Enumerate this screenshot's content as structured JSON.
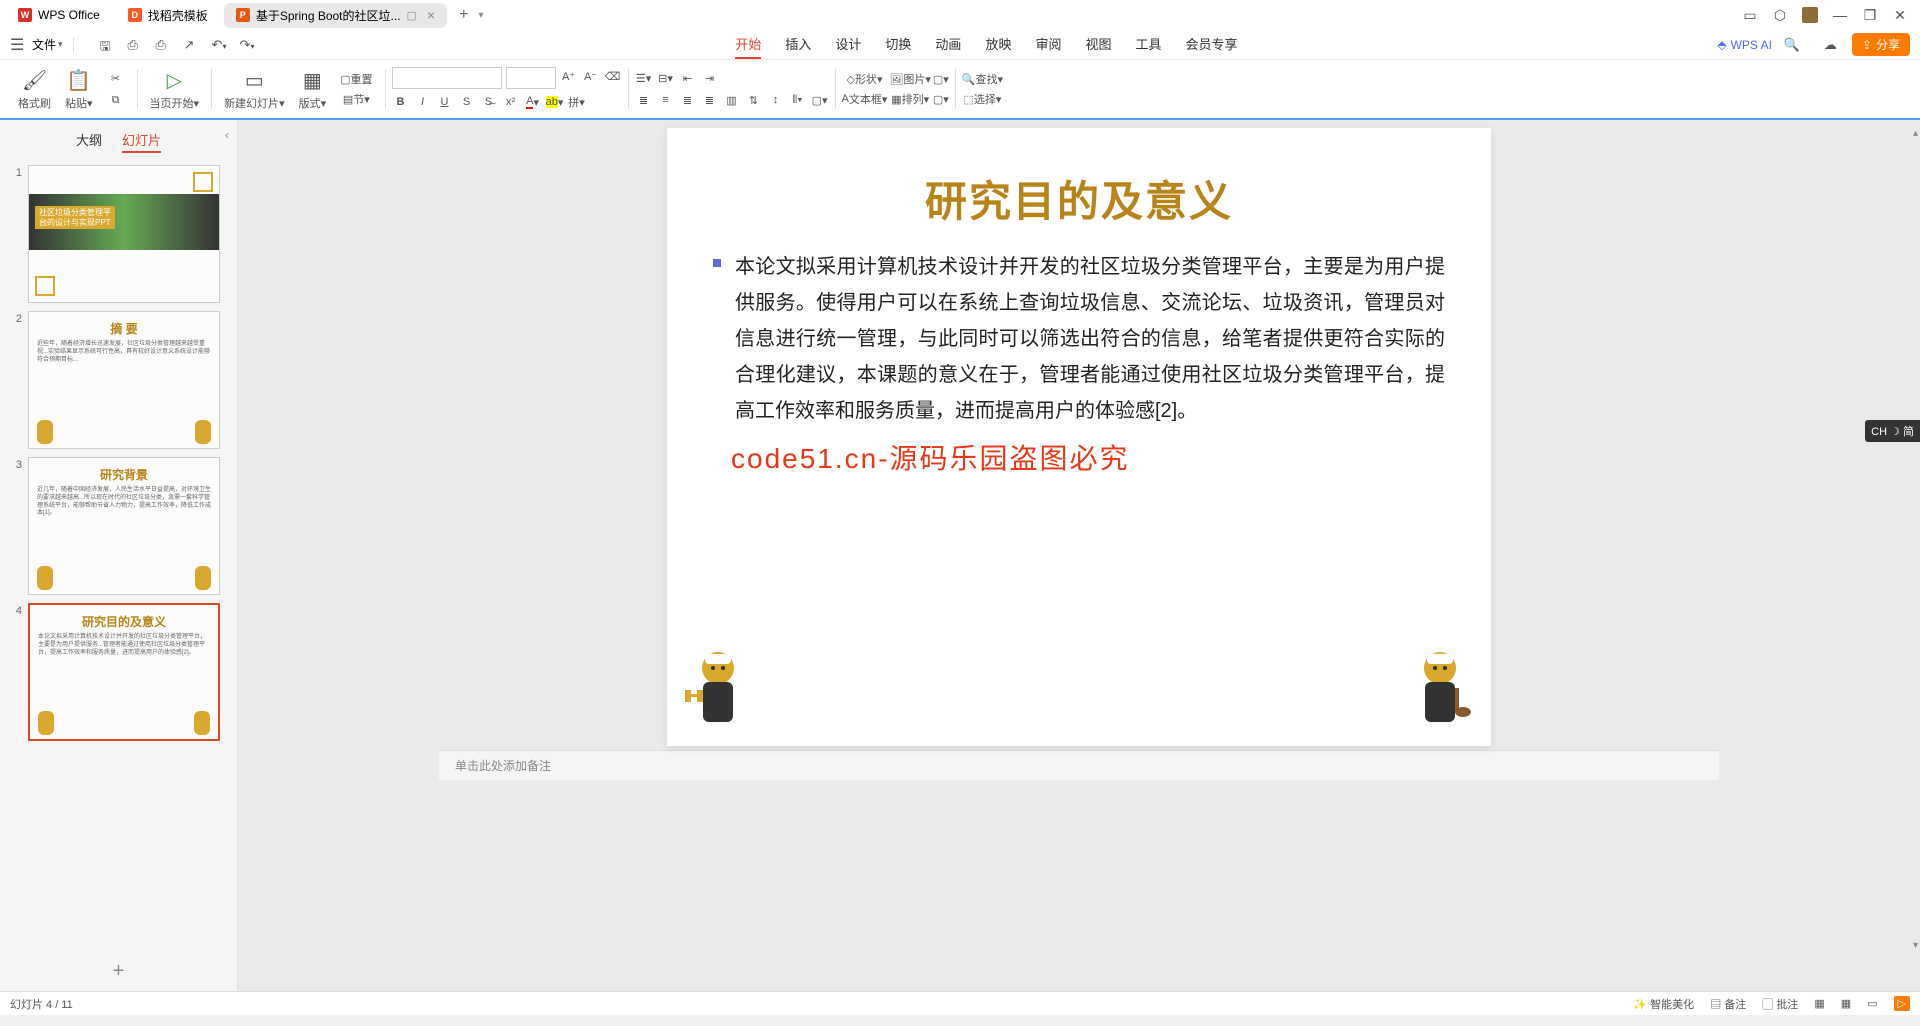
{
  "tabs": {
    "wps": "WPS Office",
    "template": "找稻壳模板",
    "doc": "基于Spring Boot的社区垃..."
  },
  "file_menu": "文件",
  "menu": [
    "开始",
    "插入",
    "设计",
    "切换",
    "动画",
    "放映",
    "审阅",
    "视图",
    "工具",
    "会员专享"
  ],
  "wps_ai": "WPS AI",
  "share": "分享",
  "ribbon": {
    "format_painter": "格式刷",
    "paste": "粘贴",
    "from_current": "当页开始",
    "new_slide": "新建幻灯片",
    "layout": "版式",
    "section": "节",
    "reset": "重置",
    "shape": "形状",
    "picture": "图片",
    "textbox": "文本框",
    "arrange": "排列",
    "find": "查找",
    "select": "选择"
  },
  "side_tabs": {
    "outline": "大纲",
    "slides": "幻灯片"
  },
  "slide": {
    "title": "研究目的及意义",
    "body": "本论文拟采用计算机技术设计并开发的社区垃圾分类管理平台，主要是为用户提供服务。使得用户可以在系统上查询垃圾信息、交流论坛、垃圾资讯，管理员对信息进行统一管理，与此同时可以筛选出符合的信息，给笔者提供更符合实际的合理化建议，本课题的意义在于，管理者能通过使用社区垃圾分类管理平台，提高工作效率和服务质量，进而提高用户的体验感[2]。"
  },
  "watermark": "code51.cn-源码乐园盗图必究",
  "notes_placeholder": "单击此处添加备注",
  "thumbs": {
    "t1_line1": "社区垃圾分类管理平",
    "t1_line2": "台的设计与实现PPT",
    "t2": "摘  要",
    "t3": "研究背景",
    "t4": "研究目的及意义"
  },
  "ime": "CH ☽ 简",
  "status": {
    "slide_info": "幻灯片 4 / 11",
    "beautify": "智能美化",
    "notes": "备注",
    "comments": "批注"
  }
}
